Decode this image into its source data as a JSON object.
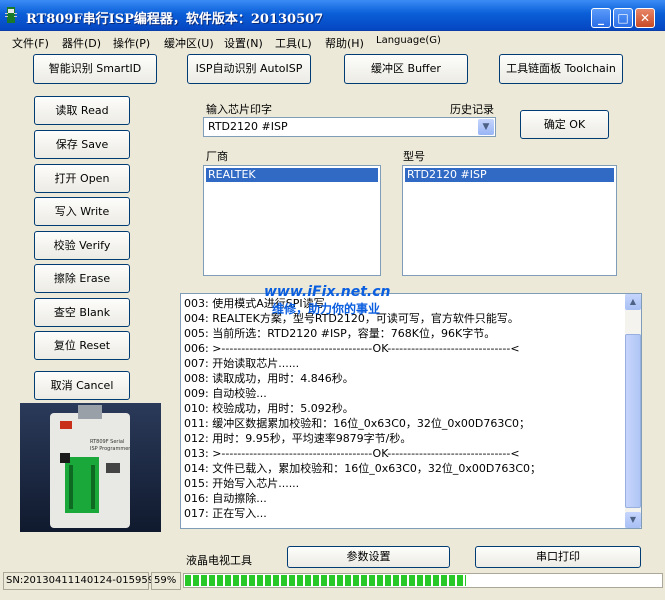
{
  "window": {
    "title": "RT809F串行ISP编程器，软件版本：20130507",
    "min_icon": "minimize-icon",
    "max_icon": "maximize-icon",
    "close_icon": "close-icon"
  },
  "menu": [
    "文件(F)",
    "器件(D)",
    "操作(P)",
    "缓冲区(U)",
    "设置(N)",
    "工具(L)",
    "帮助(H)",
    "Language(G)"
  ],
  "top_buttons": {
    "smart_id": "智能识别 SmartID",
    "auto_isp": "ISP自动识别 AutoISP",
    "buffer": "缓冲区 Buffer",
    "toolchain": "工具链面板 Toolchain"
  },
  "side_buttons": {
    "read": "读取 Read",
    "save": "保存 Save",
    "open": "打开 Open",
    "write": "写入 Write",
    "verify": "校验 Verify",
    "erase": "擦除 Erase",
    "blank": "查空 Blank",
    "reset": "复位 Reset",
    "cancel": "取消 Cancel"
  },
  "chip_input": {
    "label": "输入芯片印字",
    "history_label": "历史记录",
    "value": "RTD2120 #ISP",
    "confirm": "确定 OK"
  },
  "vendor": {
    "label": "厂商",
    "selected": "REALTEK"
  },
  "model": {
    "label": "型号",
    "selected": "RTD2120 #ISP"
  },
  "log_lines": [
    "003: 使用模式A进行SPI读写",
    "004: REALTEK方案，型号RTD2120，可读可写，官方软件只能写。",
    "005: 当前所选：RTD2120 #ISP，容量：768K位，96K字节。",
    "006: >--------------------------------------OK-------------------------------<",
    "007: 开始读取芯片......",
    "008: 读取成功，用时：4.846秒。",
    "009: 自动校验...",
    "010: 校验成功，用时：5.092秒。",
    "011: 缓冲区数据累加校验和：16位_0x63C0，32位_0x00D763C0；",
    "012: 用时：9.95秒，平均速率9879字节/秒。",
    "013: >--------------------------------------OK-------------------------------<",
    "014: 文件已载入，累加校验和：16位_0x63C0，32位_0x00D763C0；",
    "015: 开始写入芯片......",
    "016: 自动擦除...",
    "017: 正在写入..."
  ],
  "watermark": {
    "line1": "www.iFix.net.cn",
    "line2": "维修，助力你的事业"
  },
  "bottom": {
    "lcd_tools": "液晶电视工具",
    "params": "参数设置",
    "serial_print": "串口打印"
  },
  "status": {
    "serial": "SN:20130411140124-015959",
    "percent": "59%",
    "progress": 0.59
  },
  "chip_image": {
    "brand_line1": "RT809F Serial",
    "brand_line2": "ISP Programmer"
  },
  "colors": {
    "title_bar": "#0a5fd8",
    "selection": "#316ac5",
    "progress": "#28c828",
    "watermark": "#0a5ee0"
  }
}
